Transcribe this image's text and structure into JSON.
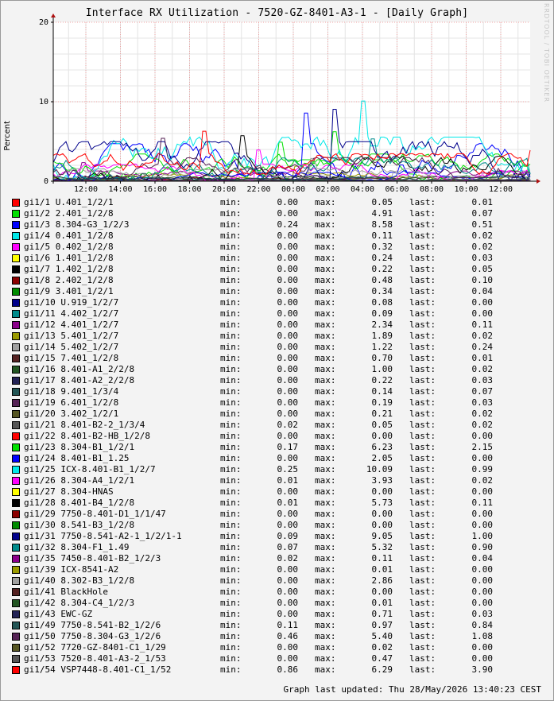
{
  "watermark": "RRDTOOL / TOBI OETIKER",
  "footer": "Graph last updated: Thu 28/May/2026 13:40:23 CEST",
  "labels": {
    "min": "min:",
    "max": "max:",
    "last": "last:"
  },
  "chart_data": {
    "type": "line",
    "title": "Interface RX Utilization - 7520-GZ-8401-A3-1 - [Daily Graph]",
    "ylabel": "Percent",
    "ylim": [
      0,
      20
    ],
    "yticks": [
      0,
      10,
      20
    ],
    "x_ticks": [
      "12:00",
      "14:00",
      "16:00",
      "18:00",
      "20:00",
      "22:00",
      "00:00",
      "02:00",
      "04:00",
      "06:00",
      "08:00",
      "10:00",
      "12:00"
    ],
    "grid": true,
    "legend_position": "bottom",
    "series": [
      {
        "name": "gi1/1 U.401_1/2/1",
        "color": "#ff0000",
        "min": "0.00",
        "max": "0.05",
        "last": "0.01"
      },
      {
        "name": "gi1/2 2.401_1/2/8",
        "color": "#00e000",
        "min": "0.00",
        "max": "4.91",
        "last": "0.07"
      },
      {
        "name": "gi1/3 8.304-G3_1/2/3",
        "color": "#0000ff",
        "min": "0.24",
        "max": "8.58",
        "last": "0.51"
      },
      {
        "name": "gi1/4 0.401_1/2/8",
        "color": "#00e8e8",
        "min": "0.00",
        "max": "0.11",
        "last": "0.02"
      },
      {
        "name": "gi1/5 0.402_1/2/8",
        "color": "#ff00ff",
        "min": "0.00",
        "max": "0.32",
        "last": "0.02"
      },
      {
        "name": "gi1/6 1.401_1/2/8",
        "color": "#ffff00",
        "min": "0.00",
        "max": "0.24",
        "last": "0.03"
      },
      {
        "name": "gi1/7 1.402_1/2/8",
        "color": "#000000",
        "min": "0.00",
        "max": "0.22",
        "last": "0.05"
      },
      {
        "name": "gi1/8 2.402_1/2/8",
        "color": "#8b0000",
        "min": "0.00",
        "max": "0.48",
        "last": "0.10"
      },
      {
        "name": "gi1/9 3.401_1/2/1",
        "color": "#008c00",
        "min": "0.00",
        "max": "0.34",
        "last": "0.04"
      },
      {
        "name": "gi1/10 U.919_1/2/7",
        "color": "#00008b",
        "min": "0.00",
        "max": "0.08",
        "last": "0.00"
      },
      {
        "name": "gi1/11 4.402_1/2/7",
        "color": "#008b8b",
        "min": "0.00",
        "max": "0.09",
        "last": "0.00"
      },
      {
        "name": "gi1/12 4.401_1/2/7",
        "color": "#8b008b",
        "min": "0.00",
        "max": "2.34",
        "last": "0.11"
      },
      {
        "name": "gi1/13 5.401_1/2/7",
        "color": "#9a9a00",
        "min": "0.00",
        "max": "1.89",
        "last": "0.02"
      },
      {
        "name": "gi1/14 5.402_1/2/7",
        "color": "#a0a0a0",
        "min": "0.00",
        "max": "1.22",
        "last": "0.24"
      },
      {
        "name": "gi1/15 7.401_1/2/8",
        "color": "#552222",
        "min": "0.00",
        "max": "0.70",
        "last": "0.01"
      },
      {
        "name": "gi1/16 8.401-A1_2/2/8",
        "color": "#225522",
        "min": "0.00",
        "max": "1.00",
        "last": "0.02"
      },
      {
        "name": "gi1/17 8.401-A2_2/2/8",
        "color": "#222255",
        "min": "0.00",
        "max": "0.22",
        "last": "0.03"
      },
      {
        "name": "gi1/18 9.401_1/3/4",
        "color": "#225555",
        "min": "0.00",
        "max": "0.14",
        "last": "0.07"
      },
      {
        "name": "gi1/19 6.401_1/2/8",
        "color": "#552255",
        "min": "0.00",
        "max": "0.19",
        "last": "0.03"
      },
      {
        "name": "gi1/20 3.402_1/2/1",
        "color": "#555522",
        "min": "0.00",
        "max": "0.21",
        "last": "0.02"
      },
      {
        "name": "gi1/21 8.401-B2-2_1/3/4",
        "color": "#555555",
        "min": "0.02",
        "max": "0.05",
        "last": "0.02"
      },
      {
        "name": "gi1/22 8.401-B2-HB_1/2/8",
        "color": "#ff0000",
        "min": "0.00",
        "max": "0.00",
        "last": "0.00"
      },
      {
        "name": "gi1/23 8.304-B1_1/2/1",
        "color": "#00e000",
        "min": "0.17",
        "max": "6.23",
        "last": "2.15"
      },
      {
        "name": "gi1/24 8.401-B1_1.25",
        "color": "#0000ff",
        "min": "0.00",
        "max": "2.05",
        "last": "0.00"
      },
      {
        "name": "gi1/25 ICX-8.401-B1_1/2/7",
        "color": "#00e8e8",
        "min": "0.25",
        "max": "10.09",
        "last": "0.99"
      },
      {
        "name": "gi1/26 8.304-A4_1/2/1",
        "color": "#ff00ff",
        "min": "0.01",
        "max": "3.93",
        "last": "0.02"
      },
      {
        "name": "gi1/27 8.304-HNAS",
        "color": "#ffff00",
        "min": "0.00",
        "max": "0.00",
        "last": "0.00"
      },
      {
        "name": "gi1/28 8.401-B4_1/2/8",
        "color": "#000000",
        "min": "0.01",
        "max": "5.73",
        "last": "0.11"
      },
      {
        "name": "gi1/29 7750-8.401-D1_1/1/47",
        "color": "#8b0000",
        "min": "0.00",
        "max": "0.00",
        "last": "0.00"
      },
      {
        "name": "gi1/30 8.541-B3_1/2/8",
        "color": "#008c00",
        "min": "0.00",
        "max": "0.00",
        "last": "0.00"
      },
      {
        "name": "gi1/31 7750-8.541-A2-1_1/2/1-1",
        "color": "#00008b",
        "min": "0.09",
        "max": "9.05",
        "last": "1.00"
      },
      {
        "name": "gi1/32 8.304-F1_1.49",
        "color": "#008b8b",
        "min": "0.07",
        "max": "5.32",
        "last": "0.90"
      },
      {
        "name": "gi1/35 7450-8.401-B2_1/2/3",
        "color": "#8b008b",
        "min": "0.02",
        "max": "0.11",
        "last": "0.04"
      },
      {
        "name": "gi1/39 ICX-8541-A2",
        "color": "#9a9a00",
        "min": "0.00",
        "max": "0.01",
        "last": "0.00"
      },
      {
        "name": "gi1/40 8.302-B3_1/2/8",
        "color": "#a0a0a0",
        "min": "0.00",
        "max": "2.86",
        "last": "0.00"
      },
      {
        "name": "gi1/41 BlackHole",
        "color": "#552222",
        "min": "0.00",
        "max": "0.00",
        "last": "0.00"
      },
      {
        "name": "gi1/42 8.304-C4_1/2/3",
        "color": "#225522",
        "min": "0.00",
        "max": "0.01",
        "last": "0.00"
      },
      {
        "name": "gi1/43 EWC-GZ",
        "color": "#222255",
        "min": "0.00",
        "max": "0.71",
        "last": "0.03"
      },
      {
        "name": "gi1/49 7750-8.541-B2_1/2/6",
        "color": "#225555",
        "min": "0.11",
        "max": "0.97",
        "last": "0.84"
      },
      {
        "name": "gi1/50 7750-8.304-G3_1/2/6",
        "color": "#552255",
        "min": "0.46",
        "max": "5.40",
        "last": "1.08"
      },
      {
        "name": "gi1/52 7720-GZ-8401-C1_1/29",
        "color": "#555522",
        "min": "0.00",
        "max": "0.02",
        "last": "0.00"
      },
      {
        "name": "gi1/53 7520-8.401-A3-2_1/53",
        "color": "#555555",
        "min": "0.00",
        "max": "0.47",
        "last": "0.00"
      },
      {
        "name": "gi1/54 VSP7448-8.401-C1_1/52",
        "color": "#ff0000",
        "min": "0.86",
        "max": "6.29",
        "last": "3.90"
      }
    ]
  }
}
